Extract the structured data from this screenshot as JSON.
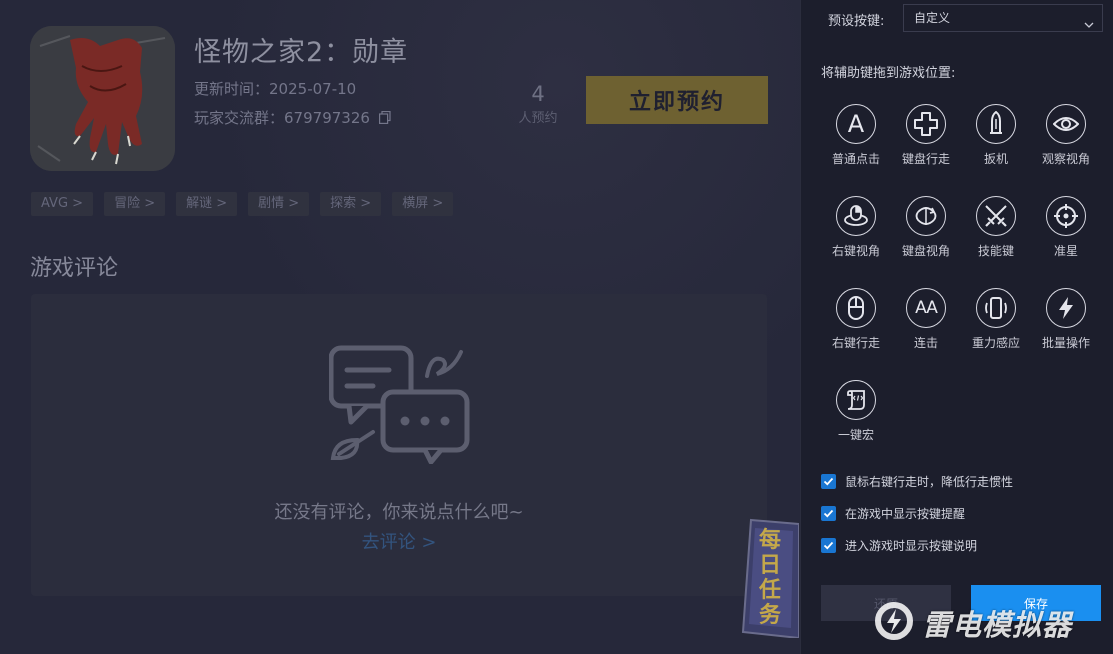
{
  "game": {
    "title": "怪物之家2：勋章",
    "update_label": "更新时间：",
    "update_date": "2025-07-10",
    "group_label": "玩家交流群：",
    "group_id": "679797326",
    "reserve_count": "4",
    "reserve_count_label": "人预约",
    "reserve_button": "立即预约",
    "tags": [
      "AVG >",
      "冒险 >",
      "解谜 >",
      "剧情 >",
      "探索 >",
      "横屏 >"
    ]
  },
  "reviews": {
    "section_title": "游戏评论",
    "empty_text": "还没有评论，你来说点什么吧~",
    "go_review_link": "去评论 >"
  },
  "daily_task": {
    "text": "每日任务"
  },
  "panel": {
    "preset_label": "预设按键:",
    "preset_value": "自定义",
    "drag_hint": "将辅助键拖到游戏位置:",
    "keys": [
      {
        "label": "普通点击",
        "icon": "letter-a-icon"
      },
      {
        "label": "键盘行走",
        "icon": "dpad-icon"
      },
      {
        "label": "扳机",
        "icon": "bullet-icon"
      },
      {
        "label": "观察视角",
        "icon": "eye-icon"
      },
      {
        "label": "右键视角",
        "icon": "mouse-rotate-icon"
      },
      {
        "label": "键盘视角",
        "icon": "rotate-view-icon"
      },
      {
        "label": "技能键",
        "icon": "crossed-swords-icon"
      },
      {
        "label": "准星",
        "icon": "crosshair-icon"
      },
      {
        "label": "右键行走",
        "icon": "mouse-icon"
      },
      {
        "label": "连击",
        "icon": "double-a-icon"
      },
      {
        "label": "重力感应",
        "icon": "phone-vibrate-icon"
      },
      {
        "label": "批量操作",
        "icon": "lightning-icon"
      },
      {
        "label": "一键宏",
        "icon": "script-icon"
      }
    ],
    "key_glyphs": {
      "a": "A",
      "aa": "AA"
    },
    "options": [
      {
        "label": "鼠标右键行走时，降低行走惯性",
        "checked": true
      },
      {
        "label": "在游戏中显示按键提醒",
        "checked": true
      },
      {
        "label": "进入游戏时显示按键说明",
        "checked": true
      }
    ],
    "reset_button": "还原",
    "save_button": "保存"
  },
  "watermark": {
    "text": "雷电模拟器"
  },
  "colors": {
    "accent": "#1a8ff0",
    "reserve": "#6e6131",
    "checkbox": "#1976d2"
  }
}
